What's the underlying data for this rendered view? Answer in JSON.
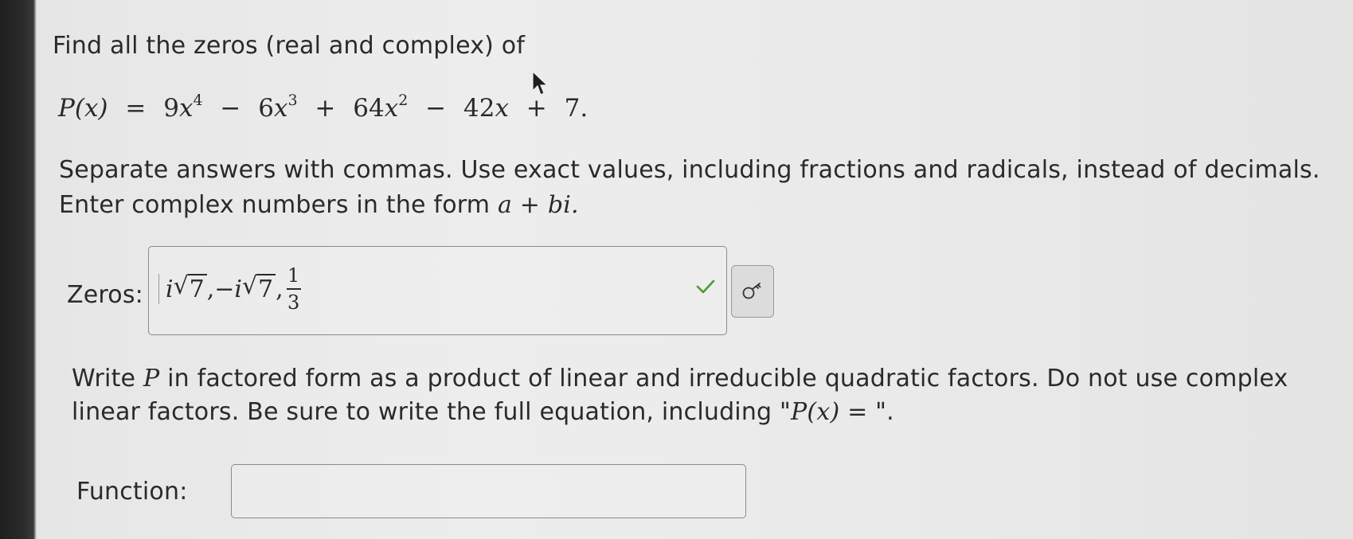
{
  "question": {
    "prompt": "Find all the zeros (real and complex) of",
    "equation": {
      "lhs": "P(x)",
      "term1_coef": "9",
      "term1_var": "x",
      "term1_exp": "4",
      "term2_coef": "6",
      "term2_var": "x",
      "term2_exp": "3",
      "term3_coef": "64",
      "term3_var": "x",
      "term3_exp": "2",
      "term4_coef": "42",
      "term4_var": "x",
      "constant": "7."
    },
    "instructions_line1": "Separate answers with commas. Use exact values, including fractions and radicals, instead of decimals.",
    "instructions_line2_prefix": "Enter complex numbers in the form",
    "instructions_line2_math": "a + bi."
  },
  "zeros_field": {
    "label": "Zeros:",
    "value_parts": {
      "i1": "i",
      "rad1": "7",
      "comma1": ",",
      "neg": "−",
      "i2": "i",
      "rad2": "7",
      "comma2": ",",
      "num": "1",
      "den": "3"
    },
    "status": "correct",
    "check_color": "#4f9a2e"
  },
  "factor_question": {
    "line1_prefix": "Write",
    "line1_var": "P",
    "line1_rest": "in factored form as a product of linear and irreducible quadratic factors. Do not use complex",
    "line2_prefix": "linear factors. Be sure to write the full equation, including \"",
    "line2_math": "P(x) = ",
    "line2_suffix": "\"."
  },
  "function_field": {
    "label": "Function:",
    "value": ""
  }
}
